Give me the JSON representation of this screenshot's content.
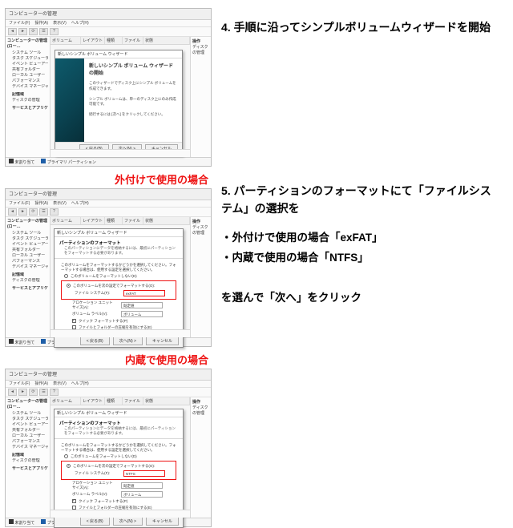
{
  "step4": {
    "heading": "4. 手順に沿ってシンプルボリュームウィザードを開始"
  },
  "step5": {
    "heading": "5. パーティションのフォーマットにて「ファイルシステム」の選択を",
    "bullet_external": "・外付けで使用の場合「exFAT」",
    "bullet_internal": "・内蔵で使用の場合「NTFS」",
    "closing": "を選んで「次へ」をクリック"
  },
  "caption_external": "外付けで使用の場合",
  "caption_internal": "内蔵で使用の場合",
  "dm": {
    "title": "コンピューターの管理",
    "menus": [
      "ファイル(F)",
      "操作(A)",
      "表示(V)",
      "ヘルプ(H)"
    ],
    "tree_root": "コンピューターの管理 (ロー…",
    "tree_sys": "システム ツール",
    "tree_items": [
      "タスク スケジューラ",
      "イベント ビューアー",
      "共有フォルダー",
      "ローカル ユーザー",
      "パフォーマンス",
      "デバイス マネージャー"
    ],
    "tree_storage": "記憶域",
    "tree_disk": "ディスクの管理",
    "tree_svc": "サービスとアプリケーション",
    "cols": [
      "ボリューム",
      "レイアウト",
      "種類",
      "ファイル",
      "状態"
    ],
    "right_head": "操作",
    "right_item": "ディスクの管理",
    "status_a": "未割り当て",
    "status_b": "プライマリ パーティション"
  },
  "wizard4": {
    "bar": "新しいシンプル ボリューム ウィザード",
    "title": "新しいシンプル ボリューム ウィザードの開始",
    "p1": "このウィザードでディスク上にシンプル ボリュームを作成できます。",
    "p2": "シンプル ボリュームは、単一のディスク上にのみ作成可能です。",
    "p3": "続行するには [次へ] をクリックしてください。",
    "back": "< 戻る(B)",
    "next": "次へ(N) >",
    "cancel": "キャンセル"
  },
  "wizard5": {
    "bar": "新しいシンプル ボリューム ウィザード",
    "h1": "パーティションのフォーマット",
    "h2": "このパーティションにデータを格納するには、最初にパーティションをフォーマットする必要があります。",
    "lead": "このボリュームをフォーマットするかどうかを選択してください。フォーマットする場合は、使用する設定を選択してください。",
    "opt_no": "このボリュームをフォーマットしない(D)",
    "opt_yes": "このボリュームを次の設定でフォーマットする(O):",
    "lab_fs": "ファイル システム(F):",
    "lab_au": "アロケーション ユニット サイズ(A):",
    "lab_label": "ボリューム ラベル(V):",
    "val_fs_ext": "exFAT",
    "val_fs_int": "NTFS",
    "val_au": "既定値",
    "val_label": "ボリューム",
    "chk_quick": "クイック フォーマットする(P)",
    "chk_comp": "ファイルとフォルダーの圧縮を有効にする(E)",
    "back": "< 戻る(B)",
    "next": "次へ(N) >",
    "cancel": "キャンセル"
  }
}
